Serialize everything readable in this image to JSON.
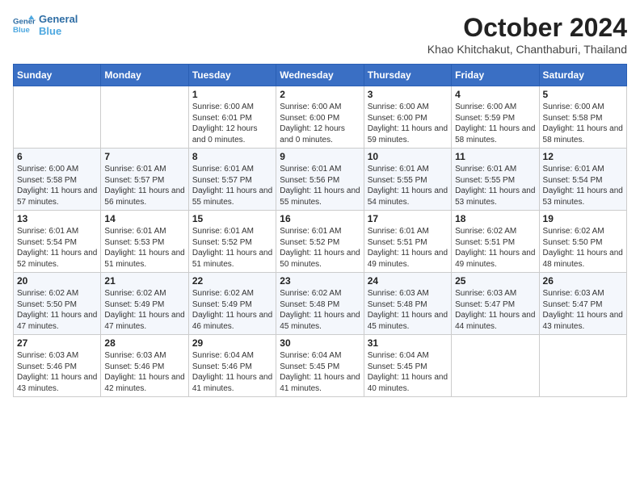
{
  "header": {
    "logo_line1": "General",
    "logo_line2": "Blue",
    "month_title": "October 2024",
    "location": "Khao Khitchakut, Chanthaburi, Thailand"
  },
  "weekdays": [
    "Sunday",
    "Monday",
    "Tuesday",
    "Wednesday",
    "Thursday",
    "Friday",
    "Saturday"
  ],
  "weeks": [
    [
      {
        "day": "",
        "sunrise": "",
        "sunset": "",
        "daylight": ""
      },
      {
        "day": "",
        "sunrise": "",
        "sunset": "",
        "daylight": ""
      },
      {
        "day": "1",
        "sunrise": "Sunrise: 6:00 AM",
        "sunset": "Sunset: 6:01 PM",
        "daylight": "Daylight: 12 hours and 0 minutes."
      },
      {
        "day": "2",
        "sunrise": "Sunrise: 6:00 AM",
        "sunset": "Sunset: 6:00 PM",
        "daylight": "Daylight: 12 hours and 0 minutes."
      },
      {
        "day": "3",
        "sunrise": "Sunrise: 6:00 AM",
        "sunset": "Sunset: 6:00 PM",
        "daylight": "Daylight: 11 hours and 59 minutes."
      },
      {
        "day": "4",
        "sunrise": "Sunrise: 6:00 AM",
        "sunset": "Sunset: 5:59 PM",
        "daylight": "Daylight: 11 hours and 58 minutes."
      },
      {
        "day": "5",
        "sunrise": "Sunrise: 6:00 AM",
        "sunset": "Sunset: 5:58 PM",
        "daylight": "Daylight: 11 hours and 58 minutes."
      }
    ],
    [
      {
        "day": "6",
        "sunrise": "Sunrise: 6:00 AM",
        "sunset": "Sunset: 5:58 PM",
        "daylight": "Daylight: 11 hours and 57 minutes."
      },
      {
        "day": "7",
        "sunrise": "Sunrise: 6:01 AM",
        "sunset": "Sunset: 5:57 PM",
        "daylight": "Daylight: 11 hours and 56 minutes."
      },
      {
        "day": "8",
        "sunrise": "Sunrise: 6:01 AM",
        "sunset": "Sunset: 5:57 PM",
        "daylight": "Daylight: 11 hours and 55 minutes."
      },
      {
        "day": "9",
        "sunrise": "Sunrise: 6:01 AM",
        "sunset": "Sunset: 5:56 PM",
        "daylight": "Daylight: 11 hours and 55 minutes."
      },
      {
        "day": "10",
        "sunrise": "Sunrise: 6:01 AM",
        "sunset": "Sunset: 5:55 PM",
        "daylight": "Daylight: 11 hours and 54 minutes."
      },
      {
        "day": "11",
        "sunrise": "Sunrise: 6:01 AM",
        "sunset": "Sunset: 5:55 PM",
        "daylight": "Daylight: 11 hours and 53 minutes."
      },
      {
        "day": "12",
        "sunrise": "Sunrise: 6:01 AM",
        "sunset": "Sunset: 5:54 PM",
        "daylight": "Daylight: 11 hours and 53 minutes."
      }
    ],
    [
      {
        "day": "13",
        "sunrise": "Sunrise: 6:01 AM",
        "sunset": "Sunset: 5:54 PM",
        "daylight": "Daylight: 11 hours and 52 minutes."
      },
      {
        "day": "14",
        "sunrise": "Sunrise: 6:01 AM",
        "sunset": "Sunset: 5:53 PM",
        "daylight": "Daylight: 11 hours and 51 minutes."
      },
      {
        "day": "15",
        "sunrise": "Sunrise: 6:01 AM",
        "sunset": "Sunset: 5:52 PM",
        "daylight": "Daylight: 11 hours and 51 minutes."
      },
      {
        "day": "16",
        "sunrise": "Sunrise: 6:01 AM",
        "sunset": "Sunset: 5:52 PM",
        "daylight": "Daylight: 11 hours and 50 minutes."
      },
      {
        "day": "17",
        "sunrise": "Sunrise: 6:01 AM",
        "sunset": "Sunset: 5:51 PM",
        "daylight": "Daylight: 11 hours and 49 minutes."
      },
      {
        "day": "18",
        "sunrise": "Sunrise: 6:02 AM",
        "sunset": "Sunset: 5:51 PM",
        "daylight": "Daylight: 11 hours and 49 minutes."
      },
      {
        "day": "19",
        "sunrise": "Sunrise: 6:02 AM",
        "sunset": "Sunset: 5:50 PM",
        "daylight": "Daylight: 11 hours and 48 minutes."
      }
    ],
    [
      {
        "day": "20",
        "sunrise": "Sunrise: 6:02 AM",
        "sunset": "Sunset: 5:50 PM",
        "daylight": "Daylight: 11 hours and 47 minutes."
      },
      {
        "day": "21",
        "sunrise": "Sunrise: 6:02 AM",
        "sunset": "Sunset: 5:49 PM",
        "daylight": "Daylight: 11 hours and 47 minutes."
      },
      {
        "day": "22",
        "sunrise": "Sunrise: 6:02 AM",
        "sunset": "Sunset: 5:49 PM",
        "daylight": "Daylight: 11 hours and 46 minutes."
      },
      {
        "day": "23",
        "sunrise": "Sunrise: 6:02 AM",
        "sunset": "Sunset: 5:48 PM",
        "daylight": "Daylight: 11 hours and 45 minutes."
      },
      {
        "day": "24",
        "sunrise": "Sunrise: 6:03 AM",
        "sunset": "Sunset: 5:48 PM",
        "daylight": "Daylight: 11 hours and 45 minutes."
      },
      {
        "day": "25",
        "sunrise": "Sunrise: 6:03 AM",
        "sunset": "Sunset: 5:47 PM",
        "daylight": "Daylight: 11 hours and 44 minutes."
      },
      {
        "day": "26",
        "sunrise": "Sunrise: 6:03 AM",
        "sunset": "Sunset: 5:47 PM",
        "daylight": "Daylight: 11 hours and 43 minutes."
      }
    ],
    [
      {
        "day": "27",
        "sunrise": "Sunrise: 6:03 AM",
        "sunset": "Sunset: 5:46 PM",
        "daylight": "Daylight: 11 hours and 43 minutes."
      },
      {
        "day": "28",
        "sunrise": "Sunrise: 6:03 AM",
        "sunset": "Sunset: 5:46 PM",
        "daylight": "Daylight: 11 hours and 42 minutes."
      },
      {
        "day": "29",
        "sunrise": "Sunrise: 6:04 AM",
        "sunset": "Sunset: 5:46 PM",
        "daylight": "Daylight: 11 hours and 41 minutes."
      },
      {
        "day": "30",
        "sunrise": "Sunrise: 6:04 AM",
        "sunset": "Sunset: 5:45 PM",
        "daylight": "Daylight: 11 hours and 41 minutes."
      },
      {
        "day": "31",
        "sunrise": "Sunrise: 6:04 AM",
        "sunset": "Sunset: 5:45 PM",
        "daylight": "Daylight: 11 hours and 40 minutes."
      },
      {
        "day": "",
        "sunrise": "",
        "sunset": "",
        "daylight": ""
      },
      {
        "day": "",
        "sunrise": "",
        "sunset": "",
        "daylight": ""
      }
    ]
  ]
}
